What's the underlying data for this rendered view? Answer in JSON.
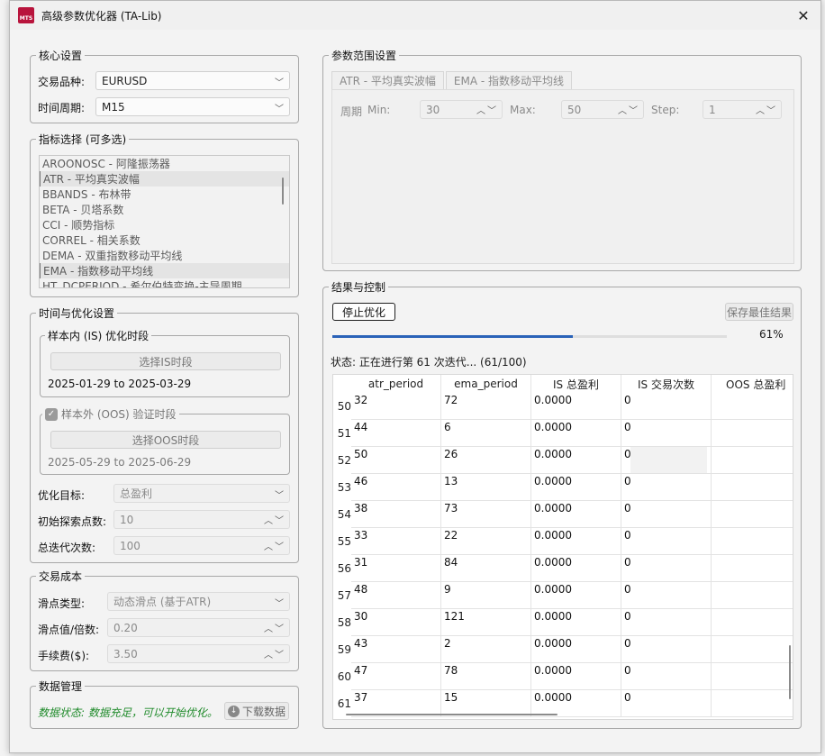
{
  "window": {
    "icon_text": "MTS",
    "title": "高级参数优化器 (TA-Lib)"
  },
  "core": {
    "legend": "核心设置",
    "symbol_label": "交易品种:",
    "symbol_value": "EURUSD",
    "timeframe_label": "时间周期:",
    "timeframe_value": "M15"
  },
  "indicators": {
    "legend": "指标选择 (可多选)",
    "items": [
      {
        "label": "AROONOSC - 阿隆振荡器",
        "selected": false
      },
      {
        "label": "ATR - 平均真实波幅",
        "selected": true
      },
      {
        "label": "BBANDS - 布林带",
        "selected": false
      },
      {
        "label": "BETA - 贝塔系数",
        "selected": false
      },
      {
        "label": "CCI - 顺势指标",
        "selected": false
      },
      {
        "label": "CORREL - 相关系数",
        "selected": false
      },
      {
        "label": "DEMA - 双重指数移动平均线",
        "selected": false
      },
      {
        "label": "EMA - 指数移动平均线",
        "selected": true
      },
      {
        "label": "HT_DCPERIOD - 希尔伯特变换-主导周期",
        "selected": false
      }
    ]
  },
  "timing": {
    "legend": "时间与优化设置",
    "is_legend": "样本内 (IS) 优化时段",
    "is_button": "选择IS时段",
    "is_range": "2025-01-29 to 2025-03-29",
    "oos_legend": "样本外 (OOS) 验证时段",
    "oos_button": "选择OOS时段",
    "oos_range": "2025-05-29 to 2025-06-29",
    "target_label": "优化目标:",
    "target_value": "总盈利",
    "init_label": "初始探索点数:",
    "init_value": "10",
    "iter_label": "总迭代次数:",
    "iter_value": "100"
  },
  "cost": {
    "legend": "交易成本",
    "slip_type_label": "滑点类型:",
    "slip_type_value": "动态滑点 (基于ATR)",
    "slip_value_label": "滑点值/倍数:",
    "slip_value": "0.20",
    "fee_label": "手续费($):",
    "fee_value": "3.50"
  },
  "data_mgmt": {
    "legend": "数据管理",
    "status": "数据状态: 数据充足，可以开始优化。",
    "download_button": "下载数据"
  },
  "params": {
    "legend": "参数范围设置",
    "tabs": [
      "ATR - 平均真实波幅",
      "EMA - 指数移动平均线"
    ],
    "period_label": "周期",
    "min_label": "Min:",
    "min_value": "30",
    "max_label": "Max:",
    "max_value": "50",
    "step_label": "Step:",
    "step_value": "1"
  },
  "results": {
    "legend": "结果与控制",
    "stop_button": "停止优化",
    "save_button": "保存最佳结果",
    "progress_percent_value": 61,
    "progress_text": "61%",
    "status": "状态: 正在进行第 61 次迭代... (61/100)",
    "columns": [
      "atr_period",
      "ema_period",
      "IS 总盈利",
      "IS 交易次数",
      "OOS 总盈利"
    ],
    "rows": [
      {
        "num": "50",
        "atr": "32",
        "ema": "72",
        "profit": "0.0000",
        "trades": "0",
        "oos": ""
      },
      {
        "num": "51",
        "atr": "44",
        "ema": "6",
        "profit": "0.0000",
        "trades": "0",
        "oos": ""
      },
      {
        "num": "52",
        "atr": "50",
        "ema": "26",
        "profit": "0.0000",
        "trades": "0",
        "oos": ""
      },
      {
        "num": "53",
        "atr": "46",
        "ema": "13",
        "profit": "0.0000",
        "trades": "0",
        "oos": ""
      },
      {
        "num": "54",
        "atr": "38",
        "ema": "73",
        "profit": "0.0000",
        "trades": "0",
        "oos": ""
      },
      {
        "num": "55",
        "atr": "33",
        "ema": "22",
        "profit": "0.0000",
        "trades": "0",
        "oos": ""
      },
      {
        "num": "56",
        "atr": "31",
        "ema": "84",
        "profit": "0.0000",
        "trades": "0",
        "oos": ""
      },
      {
        "num": "57",
        "atr": "48",
        "ema": "9",
        "profit": "0.0000",
        "trades": "0",
        "oos": ""
      },
      {
        "num": "58",
        "atr": "30",
        "ema": "121",
        "profit": "0.0000",
        "trades": "0",
        "oos": ""
      },
      {
        "num": "59",
        "atr": "43",
        "ema": "2",
        "profit": "0.0000",
        "trades": "0",
        "oos": ""
      },
      {
        "num": "60",
        "atr": "47",
        "ema": "78",
        "profit": "0.0000",
        "trades": "0",
        "oos": ""
      },
      {
        "num": "61",
        "atr": "37",
        "ema": "15",
        "profit": "0.0000",
        "trades": "0",
        "oos": ""
      }
    ]
  },
  "colors": {
    "accent": "#2a62b8",
    "status_green": "#1f8a2a"
  }
}
